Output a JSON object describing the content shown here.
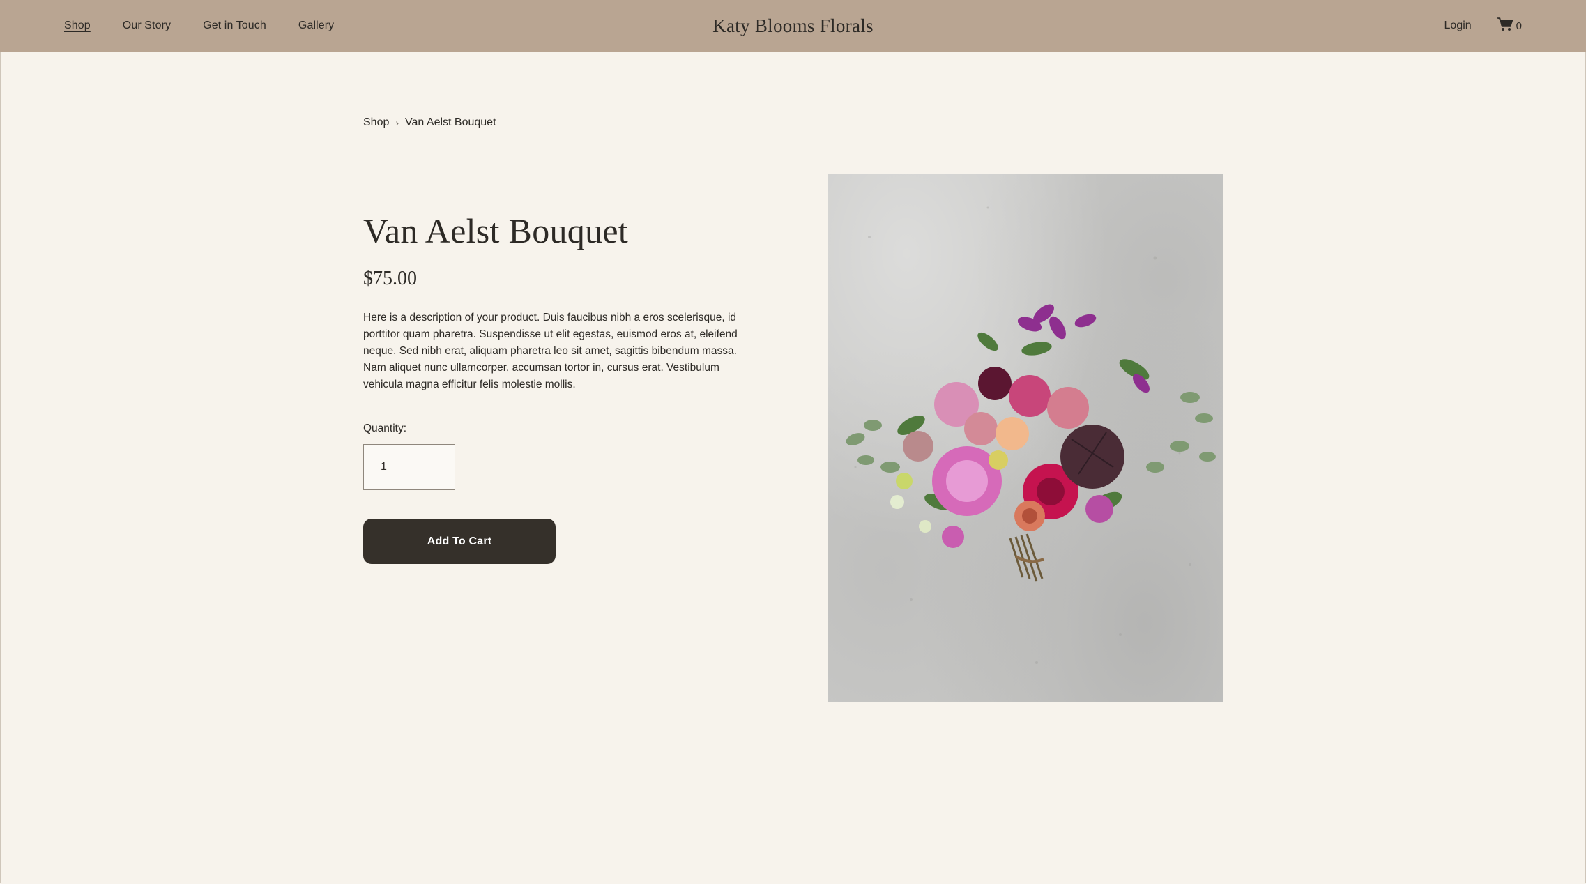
{
  "header": {
    "nav": [
      {
        "label": "Shop",
        "active": true
      },
      {
        "label": "Our Story",
        "active": false
      },
      {
        "label": "Get in Touch",
        "active": false
      },
      {
        "label": "Gallery",
        "active": false
      }
    ],
    "site_title": "Katy Blooms Florals",
    "login_label": "Login",
    "cart_icon": "cart-icon",
    "cart_count": "0"
  },
  "breadcrumb": {
    "root": "Shop",
    "separator": "›",
    "current": "Van Aelst Bouquet"
  },
  "product": {
    "title": "Van Aelst Bouquet",
    "price": "$75.00",
    "description": "Here is a description of your product. Duis faucibus nibh a eros scelerisque, id porttitor quam pharetra. Suspendisse ut elit egestas, euismod eros at, eleifend neque. Sed nibh erat, aliquam pharetra leo sit amet, sagittis bibendum massa. Nam aliquet nunc ullamcorper, accumsan tortor in, cursus erat. Vestibulum vehicula magna efficitur felis molestie mollis.",
    "quantity_label": "Quantity:",
    "quantity_value": "1",
    "add_to_cart_label": "Add To Cart"
  },
  "colors": {
    "header_bg": "#b9a592",
    "page_bg": "#f7f3ec",
    "text": "#2d2a26",
    "button_bg": "#35302a",
    "button_text": "#ffffff"
  }
}
